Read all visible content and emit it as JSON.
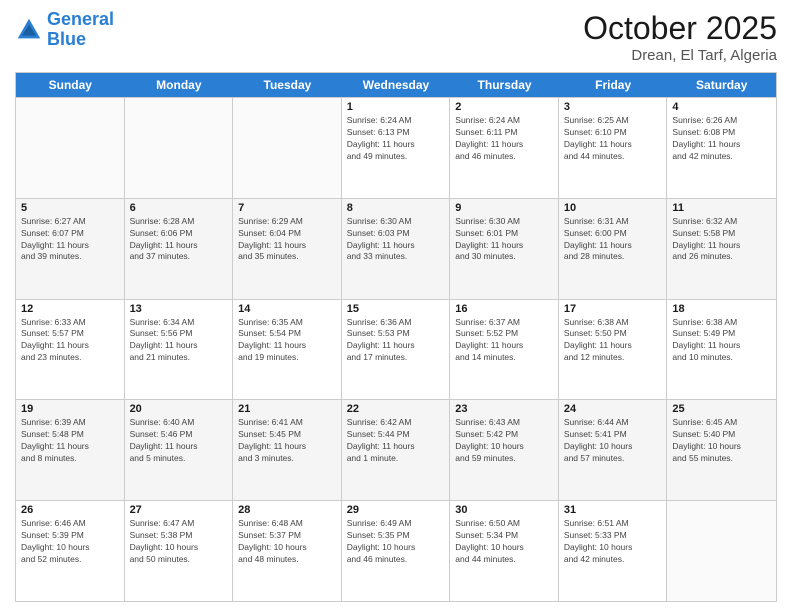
{
  "logo": {
    "line1": "General",
    "line2": "Blue"
  },
  "header": {
    "month": "October 2025",
    "location": "Drean, El Tarf, Algeria"
  },
  "weekdays": [
    "Sunday",
    "Monday",
    "Tuesday",
    "Wednesday",
    "Thursday",
    "Friday",
    "Saturday"
  ],
  "rows": [
    [
      {
        "day": "",
        "info": ""
      },
      {
        "day": "",
        "info": ""
      },
      {
        "day": "",
        "info": ""
      },
      {
        "day": "1",
        "info": "Sunrise: 6:24 AM\nSunset: 6:13 PM\nDaylight: 11 hours\nand 49 minutes."
      },
      {
        "day": "2",
        "info": "Sunrise: 6:24 AM\nSunset: 6:11 PM\nDaylight: 11 hours\nand 46 minutes."
      },
      {
        "day": "3",
        "info": "Sunrise: 6:25 AM\nSunset: 6:10 PM\nDaylight: 11 hours\nand 44 minutes."
      },
      {
        "day": "4",
        "info": "Sunrise: 6:26 AM\nSunset: 6:08 PM\nDaylight: 11 hours\nand 42 minutes."
      }
    ],
    [
      {
        "day": "5",
        "info": "Sunrise: 6:27 AM\nSunset: 6:07 PM\nDaylight: 11 hours\nand 39 minutes."
      },
      {
        "day": "6",
        "info": "Sunrise: 6:28 AM\nSunset: 6:06 PM\nDaylight: 11 hours\nand 37 minutes."
      },
      {
        "day": "7",
        "info": "Sunrise: 6:29 AM\nSunset: 6:04 PM\nDaylight: 11 hours\nand 35 minutes."
      },
      {
        "day": "8",
        "info": "Sunrise: 6:30 AM\nSunset: 6:03 PM\nDaylight: 11 hours\nand 33 minutes."
      },
      {
        "day": "9",
        "info": "Sunrise: 6:30 AM\nSunset: 6:01 PM\nDaylight: 11 hours\nand 30 minutes."
      },
      {
        "day": "10",
        "info": "Sunrise: 6:31 AM\nSunset: 6:00 PM\nDaylight: 11 hours\nand 28 minutes."
      },
      {
        "day": "11",
        "info": "Sunrise: 6:32 AM\nSunset: 5:58 PM\nDaylight: 11 hours\nand 26 minutes."
      }
    ],
    [
      {
        "day": "12",
        "info": "Sunrise: 6:33 AM\nSunset: 5:57 PM\nDaylight: 11 hours\nand 23 minutes."
      },
      {
        "day": "13",
        "info": "Sunrise: 6:34 AM\nSunset: 5:56 PM\nDaylight: 11 hours\nand 21 minutes."
      },
      {
        "day": "14",
        "info": "Sunrise: 6:35 AM\nSunset: 5:54 PM\nDaylight: 11 hours\nand 19 minutes."
      },
      {
        "day": "15",
        "info": "Sunrise: 6:36 AM\nSunset: 5:53 PM\nDaylight: 11 hours\nand 17 minutes."
      },
      {
        "day": "16",
        "info": "Sunrise: 6:37 AM\nSunset: 5:52 PM\nDaylight: 11 hours\nand 14 minutes."
      },
      {
        "day": "17",
        "info": "Sunrise: 6:38 AM\nSunset: 5:50 PM\nDaylight: 11 hours\nand 12 minutes."
      },
      {
        "day": "18",
        "info": "Sunrise: 6:38 AM\nSunset: 5:49 PM\nDaylight: 11 hours\nand 10 minutes."
      }
    ],
    [
      {
        "day": "19",
        "info": "Sunrise: 6:39 AM\nSunset: 5:48 PM\nDaylight: 11 hours\nand 8 minutes."
      },
      {
        "day": "20",
        "info": "Sunrise: 6:40 AM\nSunset: 5:46 PM\nDaylight: 11 hours\nand 5 minutes."
      },
      {
        "day": "21",
        "info": "Sunrise: 6:41 AM\nSunset: 5:45 PM\nDaylight: 11 hours\nand 3 minutes."
      },
      {
        "day": "22",
        "info": "Sunrise: 6:42 AM\nSunset: 5:44 PM\nDaylight: 11 hours\nand 1 minute."
      },
      {
        "day": "23",
        "info": "Sunrise: 6:43 AM\nSunset: 5:42 PM\nDaylight: 10 hours\nand 59 minutes."
      },
      {
        "day": "24",
        "info": "Sunrise: 6:44 AM\nSunset: 5:41 PM\nDaylight: 10 hours\nand 57 minutes."
      },
      {
        "day": "25",
        "info": "Sunrise: 6:45 AM\nSunset: 5:40 PM\nDaylight: 10 hours\nand 55 minutes."
      }
    ],
    [
      {
        "day": "26",
        "info": "Sunrise: 6:46 AM\nSunset: 5:39 PM\nDaylight: 10 hours\nand 52 minutes."
      },
      {
        "day": "27",
        "info": "Sunrise: 6:47 AM\nSunset: 5:38 PM\nDaylight: 10 hours\nand 50 minutes."
      },
      {
        "day": "28",
        "info": "Sunrise: 6:48 AM\nSunset: 5:37 PM\nDaylight: 10 hours\nand 48 minutes."
      },
      {
        "day": "29",
        "info": "Sunrise: 6:49 AM\nSunset: 5:35 PM\nDaylight: 10 hours\nand 46 minutes."
      },
      {
        "day": "30",
        "info": "Sunrise: 6:50 AM\nSunset: 5:34 PM\nDaylight: 10 hours\nand 44 minutes."
      },
      {
        "day": "31",
        "info": "Sunrise: 6:51 AM\nSunset: 5:33 PM\nDaylight: 10 hours\nand 42 minutes."
      },
      {
        "day": "",
        "info": ""
      }
    ]
  ]
}
